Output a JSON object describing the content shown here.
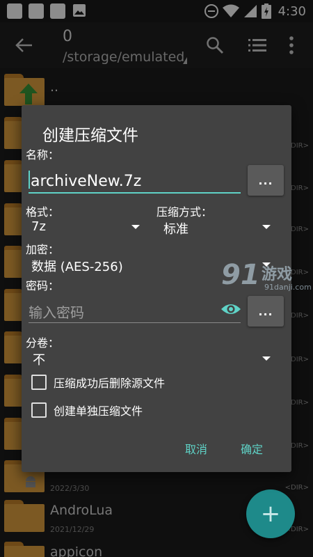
{
  "status_bar": {
    "time": "4:30"
  },
  "toolbar": {
    "count": "0",
    "path": "/storage/emulated"
  },
  "file_list": {
    "parent": "..",
    "dir_tag": "<DIR>",
    "items": [
      {
        "name": "AndroLua",
        "date": "2021/12/29"
      },
      {
        "name": "appicon",
        "date": ""
      }
    ],
    "hidden_date": "2022/3/30"
  },
  "dialog": {
    "title": "创建压缩文件",
    "name_label": "名称：",
    "name_value": "archiveNew.7z",
    "browse_label": "...",
    "format_label": "格式：",
    "format_value": "7z",
    "method_label": "压缩方式：",
    "method_value": "标准",
    "encrypt_label": "加密：",
    "encrypt_value": "数据 (AES-256)",
    "password_label": "密码：",
    "password_placeholder": "输入密码",
    "password_browse_label": "...",
    "volume_label": "分卷：",
    "volume_value": "不",
    "checkbox_delete": "压缩成功后删除源文件",
    "checkbox_separate": "创建单独压缩文件",
    "cancel": "取消",
    "ok": "确定"
  },
  "watermark": {
    "number": "91",
    "name": "游戏",
    "url": "91danji.com"
  },
  "colors": {
    "accent": "#5fd3c7",
    "folder": "#e2a240",
    "dialog_bg": "#424242",
    "fab": "#1e8a8a"
  }
}
